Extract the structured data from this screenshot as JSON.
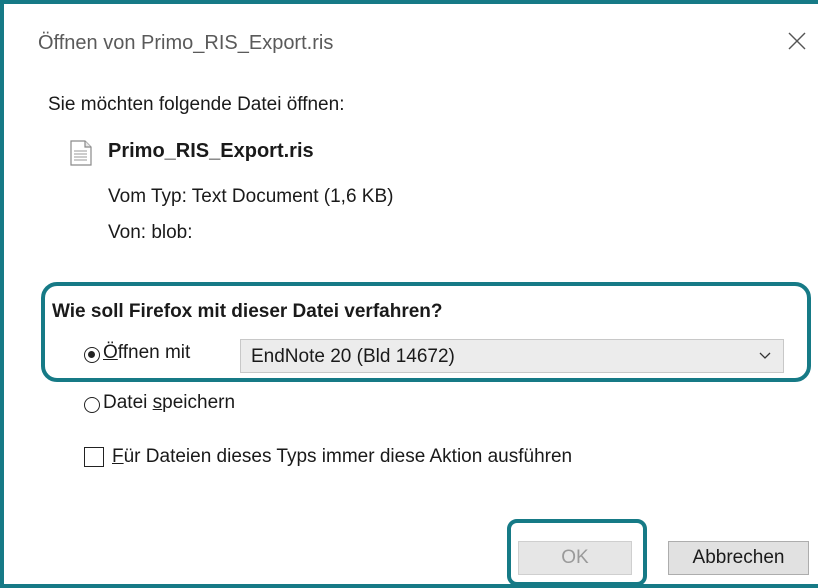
{
  "window": {
    "title": "Öffnen von Primo_RIS_Export.ris",
    "close_icon": "close-icon"
  },
  "content": {
    "intro": "Sie möchten folgende Datei öffnen:",
    "file_icon": "document-icon",
    "file_name": "Primo_RIS_Export.ris",
    "type_line": "Vom Typ: Text Document (1,6 KB)",
    "from_line": "Von: blob:"
  },
  "action": {
    "question": "Wie soll Firefox mit dieser Datei verfahren?",
    "open_with": {
      "accesskey": "Ö",
      "label_rest": "ffnen mit",
      "selected": true
    },
    "application": "EndNote 20 (Bld 14672)",
    "save_file": {
      "label_before": "Datei ",
      "accesskey": "s",
      "label_after": "peichern",
      "selected": false
    },
    "always": {
      "accesskey": "F",
      "label_rest": "ür Dateien dieses Typs immer diese Aktion ausführen",
      "checked": false
    }
  },
  "buttons": {
    "ok": "OK",
    "cancel": "Abbrechen"
  },
  "colors": {
    "highlight": "#167a86"
  }
}
